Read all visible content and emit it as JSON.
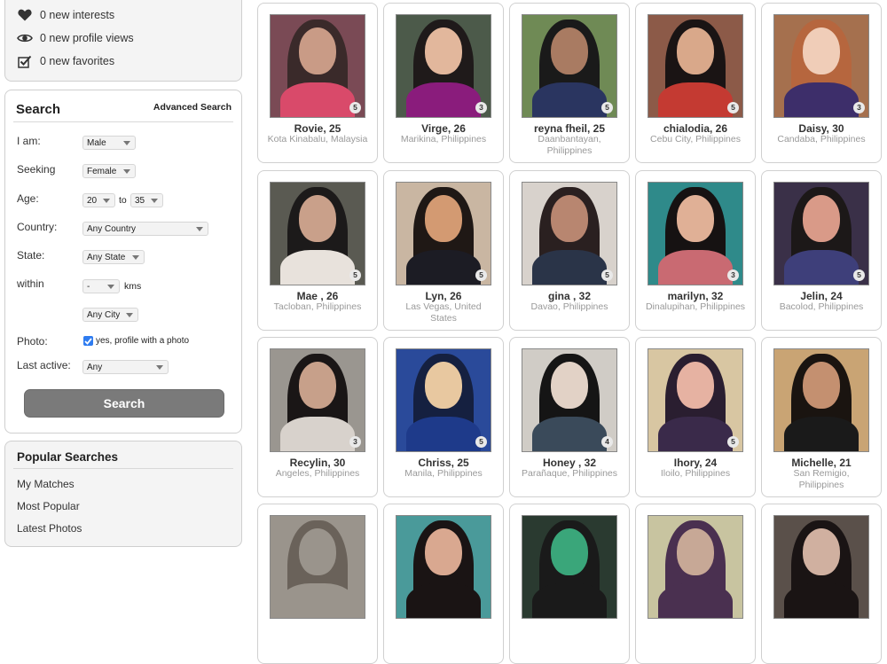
{
  "notifications": {
    "items": [
      {
        "icon": "heart-icon",
        "label": "0 new interests"
      },
      {
        "icon": "eye-icon",
        "label": "0 new profile views"
      },
      {
        "icon": "checkbox-icon",
        "label": "0 new favorites"
      }
    ]
  },
  "search": {
    "title": "Search",
    "advanced_link": "Advanced Search",
    "labels": {
      "i_am": "I am:",
      "seeking": "Seeking",
      "age": "Age:",
      "country": "Country:",
      "state": "State:",
      "within": "within",
      "photo": "Photo:",
      "last_active": "Last active:"
    },
    "values": {
      "i_am": "Male",
      "seeking": "Female",
      "age_from": "20",
      "age_to": "35",
      "age_sep": "to",
      "country": "Any Country",
      "state": "Any State",
      "within": "-",
      "within_unit": "kms",
      "city": "Any City",
      "photo_checked": true,
      "photo_text": "yes, profile with a photo",
      "last_active": "Any"
    },
    "submit_label": "Search"
  },
  "popular_searches": {
    "title": "Popular Searches",
    "links": [
      "My Matches",
      "Most Popular",
      "Latest Photos"
    ]
  },
  "profiles": [
    {
      "name": "Rovie, 25",
      "location": "Kota Kinabalu, Malaysia",
      "photos": "5",
      "colors": [
        "#7a4a55",
        "#3a2a2a",
        "#c99b86",
        "#d94a6a"
      ]
    },
    {
      "name": "Virge, 26",
      "location": "Marikina, Philippines",
      "photos": "3",
      "colors": [
        "#4c5a4a",
        "#1f1a1a",
        "#e2b79c",
        "#8a1c7c"
      ]
    },
    {
      "name": "reyna fheil, 25",
      "location": "Daanbantayan, Philippines",
      "photos": "5",
      "colors": [
        "#6f8a55",
        "#1a1a1a",
        "#a97b62",
        "#2a3560"
      ]
    },
    {
      "name": "chialodia, 26",
      "location": "Cebu City, Philippines",
      "photos": "5",
      "colors": [
        "#8c5a48",
        "#1a1414",
        "#d9a88a",
        "#c43a32"
      ]
    },
    {
      "name": "Daisy, 30",
      "location": "Candaba, Philippines",
      "photos": "3",
      "colors": [
        "#a5704e",
        "#b6663e",
        "#f0cdb8",
        "#3d2e6a"
      ]
    },
    {
      "name": "Mae , 26",
      "location": "Tacloban, Philippines",
      "photos": "5",
      "colors": [
        "#5a5a52",
        "#1c1a1a",
        "#c9a08a",
        "#e8e2dc"
      ]
    },
    {
      "name": "Lyn, 26",
      "location": "Las Vegas, United States",
      "photos": "5",
      "colors": [
        "#c9b6a2",
        "#1f1815",
        "#d39a72",
        "#1c1c24"
      ]
    },
    {
      "name": "gina , 32",
      "location": "Davao, Philippines",
      "photos": "5",
      "colors": [
        "#d8d2cc",
        "#2a2020",
        "#b88670",
        "#2a3448"
      ]
    },
    {
      "name": "marilyn, 32",
      "location": "Dinalupihan, Philippines",
      "photos": "3",
      "colors": [
        "#2f8a8a",
        "#161212",
        "#e0b096",
        "#c96a72"
      ]
    },
    {
      "name": "Jelin, 24",
      "location": "Bacolod, Philippines",
      "photos": "5",
      "colors": [
        "#3a3048",
        "#1c1818",
        "#d99a88",
        "#3e3f7a"
      ]
    },
    {
      "name": "Recylin, 30",
      "location": "Angeles, Philippines",
      "photos": "3",
      "colors": [
        "#9a9690",
        "#1a1616",
        "#c7a08a",
        "#d8d2cc"
      ]
    },
    {
      "name": "Chriss, 25",
      "location": "Manila, Philippines",
      "photos": "5",
      "colors": [
        "#2a4a9a",
        "#152040",
        "#e8c8a0",
        "#1e3a8a"
      ]
    },
    {
      "name": "Honey , 32",
      "location": "Parañaque, Philippines",
      "photos": "4",
      "colors": [
        "#d0ccc6",
        "#151515",
        "#e2d2c6",
        "#3a4a5a"
      ]
    },
    {
      "name": "Ihory, 24",
      "location": "Iloilo, Philippines",
      "photos": "5",
      "colors": [
        "#d8c6a2",
        "#2a1e30",
        "#e6b2a2",
        "#3a2a4a"
      ]
    },
    {
      "name": "Michelle, 21",
      "location": "San Remigio, Philippines",
      "photos": "",
      "colors": [
        "#c9a474",
        "#1a1410",
        "#c49070",
        "#1a1a1a"
      ]
    },
    {
      "name": "",
      "location": "",
      "photos": "",
      "colors": [
        "#9a948c",
        "#6a625a",
        "#9a948c",
        "#9a948c"
      ]
    },
    {
      "name": "",
      "location": "",
      "photos": "",
      "colors": [
        "#4a9a9a",
        "#1a1414",
        "#d9a890",
        "#1a1414"
      ]
    },
    {
      "name": "",
      "location": "",
      "photos": "",
      "colors": [
        "#2a3a30",
        "#1a1a1a",
        "#3aa67a",
        "#1a1a1a"
      ]
    },
    {
      "name": "",
      "location": "",
      "photos": "",
      "colors": [
        "#c8c4a0",
        "#4a3050",
        "#c7a896",
        "#4a3050"
      ]
    },
    {
      "name": "",
      "location": "",
      "photos": "",
      "colors": [
        "#5a504a",
        "#1a1414",
        "#d0b0a0",
        "#1a1414"
      ]
    }
  ]
}
